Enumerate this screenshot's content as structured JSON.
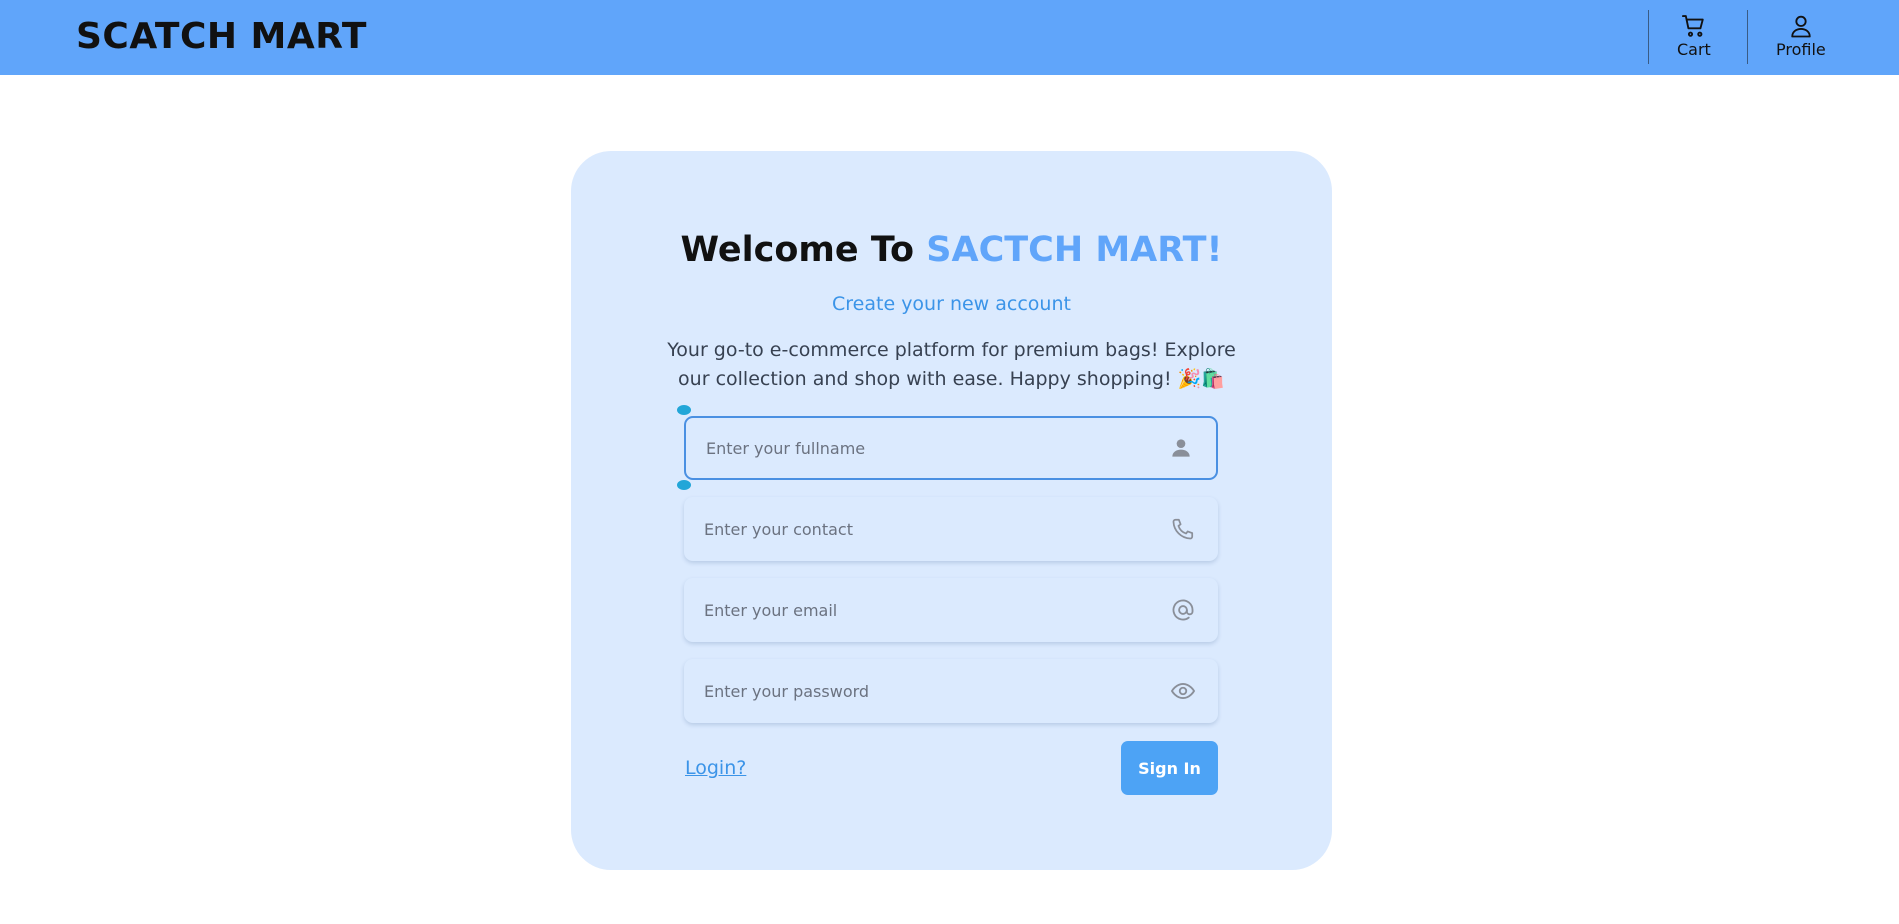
{
  "header": {
    "brand": "SCATCH MART",
    "cart_label": "Cart",
    "profile_label": "Profile",
    "cart_icon": "cart-icon",
    "profile_icon": "user-icon"
  },
  "form": {
    "title_prefix": "Welcome To ",
    "title_accent": "SACTCH MART!",
    "subtitle": "Create your new account",
    "description": "Your go-to e-commerce platform for premium bags! Explore our collection and shop with ease. Happy shopping! 🎉🛍️",
    "fields": [
      {
        "placeholder": "Enter your fullname",
        "value": "",
        "icon": "person-icon"
      },
      {
        "placeholder": "Enter your contact",
        "value": "",
        "icon": "phone-icon"
      },
      {
        "placeholder": "Enter your email",
        "value": "",
        "icon": "at-icon"
      },
      {
        "placeholder": "Enter your password",
        "value": "",
        "icon": "eye-icon"
      }
    ],
    "login_link": "Login?",
    "submit_label": "Sign In"
  },
  "colors": {
    "navbar": "#60a5fa",
    "card_background": "#dbeafe",
    "accent": "#60a5fa",
    "button": "#4da3f5"
  }
}
